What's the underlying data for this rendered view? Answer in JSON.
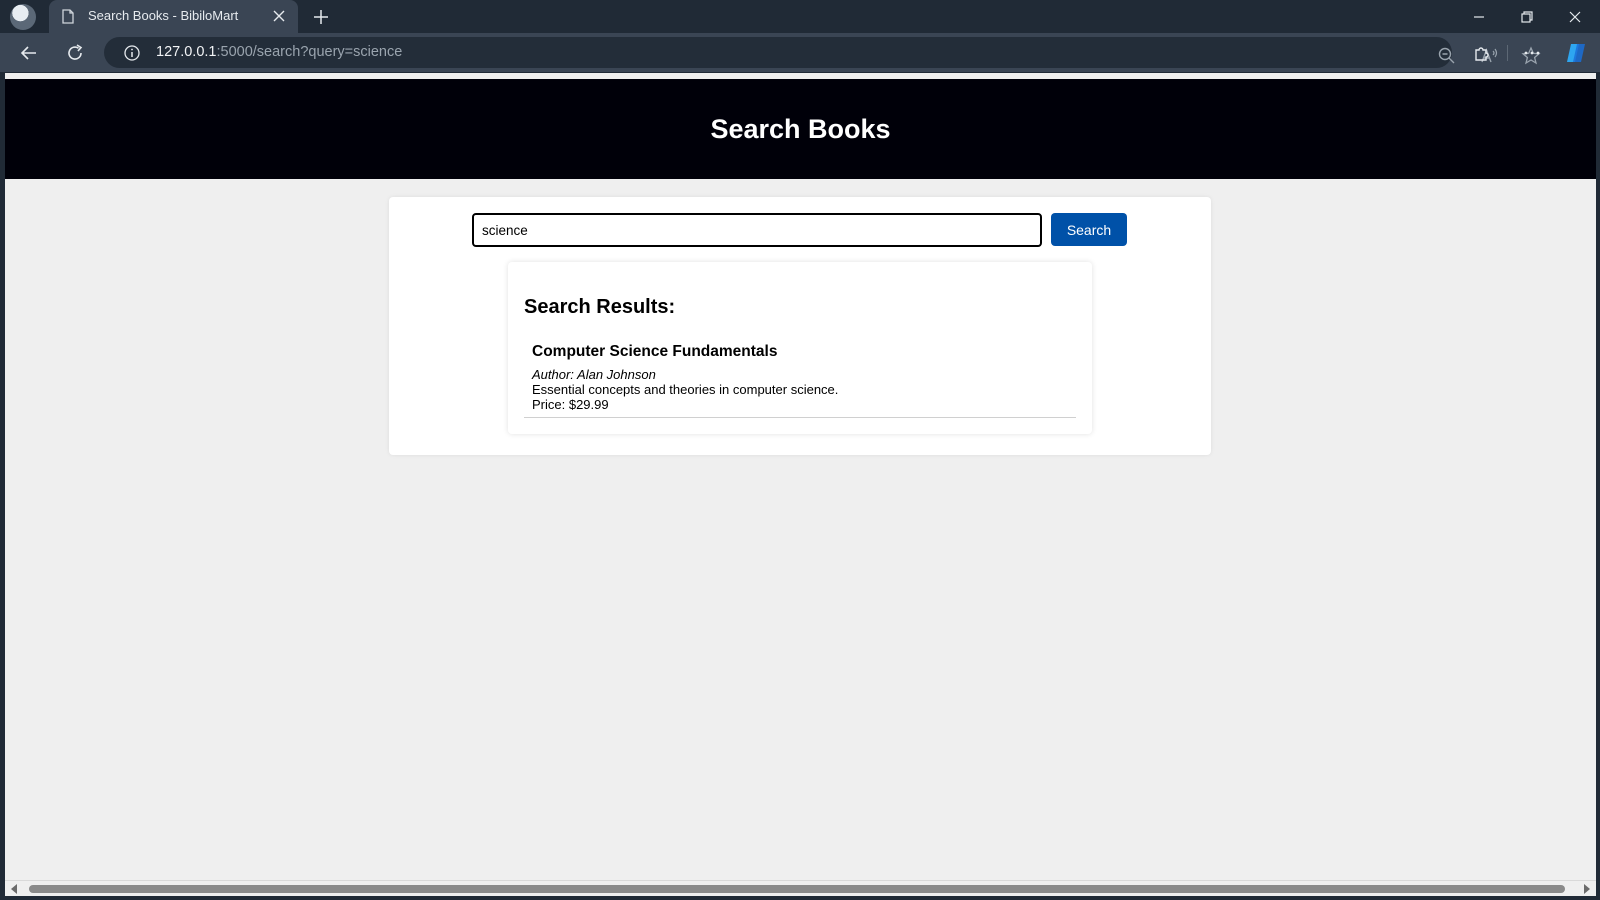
{
  "browser": {
    "tab_title": "Search Books - BibiloMart",
    "url_host": "127.0.0.1",
    "url_path": ":5000/search?query=science"
  },
  "page": {
    "header_title": "Search Books",
    "search": {
      "value": "science",
      "button_label": "Search"
    },
    "results": {
      "heading": "Search Results:",
      "books": [
        {
          "title": "Computer Science Fundamentals",
          "author": "Author: Alan Johnson",
          "description": "Essential concepts and theories in computer science.",
          "price": "Price: $29.99"
        }
      ]
    }
  },
  "colors": {
    "header_bg": "#000009",
    "button_bg": "#0051a8",
    "page_bg": "#efefef"
  }
}
